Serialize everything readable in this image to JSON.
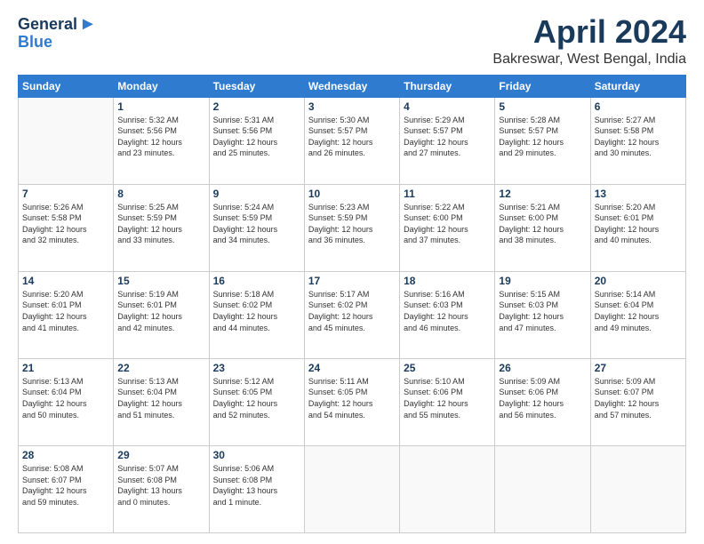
{
  "logo": {
    "line1": "General",
    "line2": "Blue"
  },
  "header": {
    "month_year": "April 2024",
    "location": "Bakreswar, West Bengal, India"
  },
  "days_of_week": [
    "Sunday",
    "Monday",
    "Tuesday",
    "Wednesday",
    "Thursday",
    "Friday",
    "Saturday"
  ],
  "weeks": [
    [
      {
        "day": "",
        "info": ""
      },
      {
        "day": "1",
        "info": "Sunrise: 5:32 AM\nSunset: 5:56 PM\nDaylight: 12 hours\nand 23 minutes."
      },
      {
        "day": "2",
        "info": "Sunrise: 5:31 AM\nSunset: 5:56 PM\nDaylight: 12 hours\nand 25 minutes."
      },
      {
        "day": "3",
        "info": "Sunrise: 5:30 AM\nSunset: 5:57 PM\nDaylight: 12 hours\nand 26 minutes."
      },
      {
        "day": "4",
        "info": "Sunrise: 5:29 AM\nSunset: 5:57 PM\nDaylight: 12 hours\nand 27 minutes."
      },
      {
        "day": "5",
        "info": "Sunrise: 5:28 AM\nSunset: 5:57 PM\nDaylight: 12 hours\nand 29 minutes."
      },
      {
        "day": "6",
        "info": "Sunrise: 5:27 AM\nSunset: 5:58 PM\nDaylight: 12 hours\nand 30 minutes."
      }
    ],
    [
      {
        "day": "7",
        "info": "Sunrise: 5:26 AM\nSunset: 5:58 PM\nDaylight: 12 hours\nand 32 minutes."
      },
      {
        "day": "8",
        "info": "Sunrise: 5:25 AM\nSunset: 5:59 PM\nDaylight: 12 hours\nand 33 minutes."
      },
      {
        "day": "9",
        "info": "Sunrise: 5:24 AM\nSunset: 5:59 PM\nDaylight: 12 hours\nand 34 minutes."
      },
      {
        "day": "10",
        "info": "Sunrise: 5:23 AM\nSunset: 5:59 PM\nDaylight: 12 hours\nand 36 minutes."
      },
      {
        "day": "11",
        "info": "Sunrise: 5:22 AM\nSunset: 6:00 PM\nDaylight: 12 hours\nand 37 minutes."
      },
      {
        "day": "12",
        "info": "Sunrise: 5:21 AM\nSunset: 6:00 PM\nDaylight: 12 hours\nand 38 minutes."
      },
      {
        "day": "13",
        "info": "Sunrise: 5:20 AM\nSunset: 6:01 PM\nDaylight: 12 hours\nand 40 minutes."
      }
    ],
    [
      {
        "day": "14",
        "info": "Sunrise: 5:20 AM\nSunset: 6:01 PM\nDaylight: 12 hours\nand 41 minutes."
      },
      {
        "day": "15",
        "info": "Sunrise: 5:19 AM\nSunset: 6:01 PM\nDaylight: 12 hours\nand 42 minutes."
      },
      {
        "day": "16",
        "info": "Sunrise: 5:18 AM\nSunset: 6:02 PM\nDaylight: 12 hours\nand 44 minutes."
      },
      {
        "day": "17",
        "info": "Sunrise: 5:17 AM\nSunset: 6:02 PM\nDaylight: 12 hours\nand 45 minutes."
      },
      {
        "day": "18",
        "info": "Sunrise: 5:16 AM\nSunset: 6:03 PM\nDaylight: 12 hours\nand 46 minutes."
      },
      {
        "day": "19",
        "info": "Sunrise: 5:15 AM\nSunset: 6:03 PM\nDaylight: 12 hours\nand 47 minutes."
      },
      {
        "day": "20",
        "info": "Sunrise: 5:14 AM\nSunset: 6:04 PM\nDaylight: 12 hours\nand 49 minutes."
      }
    ],
    [
      {
        "day": "21",
        "info": "Sunrise: 5:13 AM\nSunset: 6:04 PM\nDaylight: 12 hours\nand 50 minutes."
      },
      {
        "day": "22",
        "info": "Sunrise: 5:13 AM\nSunset: 6:04 PM\nDaylight: 12 hours\nand 51 minutes."
      },
      {
        "day": "23",
        "info": "Sunrise: 5:12 AM\nSunset: 6:05 PM\nDaylight: 12 hours\nand 52 minutes."
      },
      {
        "day": "24",
        "info": "Sunrise: 5:11 AM\nSunset: 6:05 PM\nDaylight: 12 hours\nand 54 minutes."
      },
      {
        "day": "25",
        "info": "Sunrise: 5:10 AM\nSunset: 6:06 PM\nDaylight: 12 hours\nand 55 minutes."
      },
      {
        "day": "26",
        "info": "Sunrise: 5:09 AM\nSunset: 6:06 PM\nDaylight: 12 hours\nand 56 minutes."
      },
      {
        "day": "27",
        "info": "Sunrise: 5:09 AM\nSunset: 6:07 PM\nDaylight: 12 hours\nand 57 minutes."
      }
    ],
    [
      {
        "day": "28",
        "info": "Sunrise: 5:08 AM\nSunset: 6:07 PM\nDaylight: 12 hours\nand 59 minutes."
      },
      {
        "day": "29",
        "info": "Sunrise: 5:07 AM\nSunset: 6:08 PM\nDaylight: 13 hours\nand 0 minutes."
      },
      {
        "day": "30",
        "info": "Sunrise: 5:06 AM\nSunset: 6:08 PM\nDaylight: 13 hours\nand 1 minute."
      },
      {
        "day": "",
        "info": ""
      },
      {
        "day": "",
        "info": ""
      },
      {
        "day": "",
        "info": ""
      },
      {
        "day": "",
        "info": ""
      }
    ]
  ]
}
